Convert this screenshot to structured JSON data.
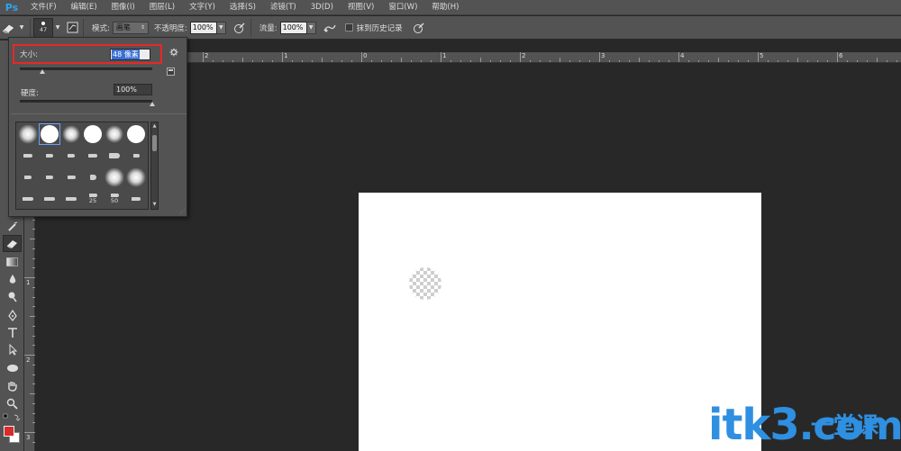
{
  "app": {
    "logo": "Ps"
  },
  "menu": [
    "文件(F)",
    "编辑(E)",
    "图像(I)",
    "图层(L)",
    "文字(Y)",
    "选择(S)",
    "滤镜(T)",
    "3D(D)",
    "视图(V)",
    "窗口(W)",
    "帮助(H)"
  ],
  "options": {
    "brush_size": "47",
    "mode_label": "模式:",
    "mode_value": "画笔",
    "opacity_label": "不透明度:",
    "opacity_value": "100%",
    "flow_label": "流量:",
    "flow_value": "100%",
    "history_label": "抹到历史记录"
  },
  "brush_panel": {
    "size_label": "大小:",
    "size_value": "48 像素",
    "size_slider_fraction": 0.17,
    "hardness_label": "硬度:",
    "hardness_value": "100%",
    "hardness_slider_fraction": 1.0,
    "preset_labels": [
      "25",
      "50"
    ]
  },
  "ruler_top": [
    "2",
    "1",
    "0",
    "1",
    "2",
    "3",
    "4",
    "5",
    "6"
  ],
  "ruler_left": [
    "1",
    "2",
    "3"
  ],
  "colors": {
    "foreground": "#d82c2c",
    "background": "#ffffff",
    "highlight_box": "#e8262b",
    "accent": "#2fa3f0"
  },
  "watermark": {
    "text": "itk3",
    "suffix": ".com",
    "cn": "一堂课"
  }
}
